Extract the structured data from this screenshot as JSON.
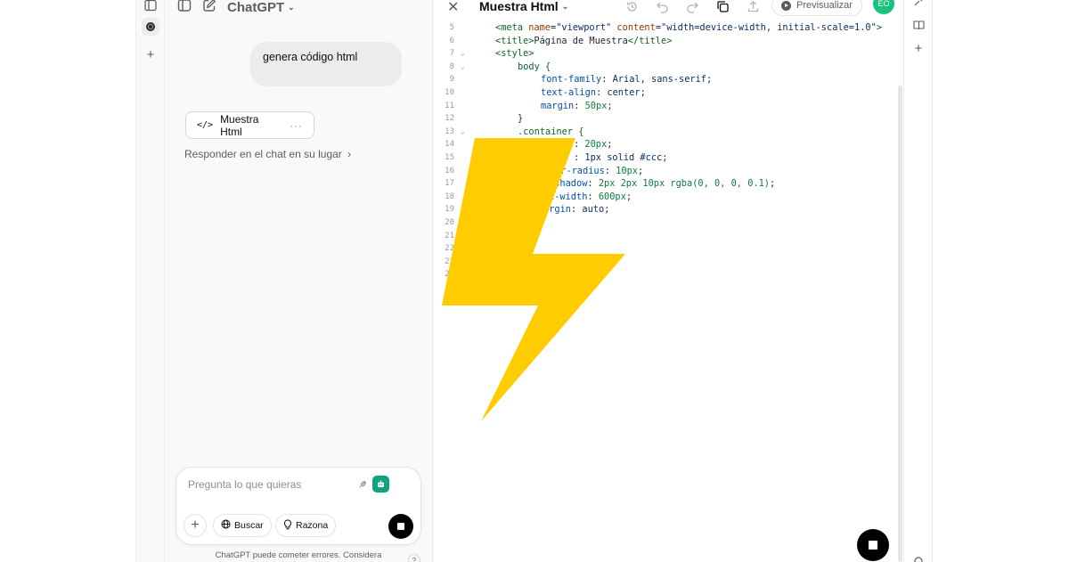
{
  "chat": {
    "title": "ChatGPT",
    "user_message": "genera código html",
    "canvas_chip_label": "Muestra Html",
    "canvas_chip_more": "···",
    "respond_link": "Responder en el chat en su lugar",
    "composer": {
      "placeholder": "Pregunta lo que quieras",
      "search_label": "Buscar",
      "reason_label": "Razona"
    },
    "disclaimer": "ChatGPT puede cometer errores. Considera",
    "help": "?"
  },
  "canvas": {
    "title": "Muestra Html",
    "preview_label": "Previsualizar",
    "avatar_initials": "EO",
    "code_lines": [
      {
        "n": "5",
        "fold": false
      },
      {
        "n": "6",
        "fold": false
      },
      {
        "n": "7",
        "fold": true
      },
      {
        "n": "8",
        "fold": true
      },
      {
        "n": "9",
        "fold": false
      },
      {
        "n": "10",
        "fold": false
      },
      {
        "n": "11",
        "fold": false
      },
      {
        "n": "12",
        "fold": false
      },
      {
        "n": "13",
        "fold": true
      },
      {
        "n": "14",
        "fold": false
      },
      {
        "n": "15",
        "fold": false
      },
      {
        "n": "16",
        "fold": false
      },
      {
        "n": "17",
        "fold": false
      },
      {
        "n": "18",
        "fold": false
      },
      {
        "n": "19",
        "fold": false
      },
      {
        "n": "20",
        "fold": false
      },
      {
        "n": "21",
        "fold": false
      },
      {
        "n": "22",
        "fold": false
      },
      {
        "n": "23",
        "fold": false
      },
      {
        "n": "24",
        "fold": false
      }
    ],
    "code_text": {
      "l5a": "<meta ",
      "l5b": "name",
      "l5c": "=",
      "l5d": "\"viewport\"",
      "l5e": " content",
      "l5f": "=",
      "l5g": "\"width=device-width, initial-scale=1.0\"",
      "l5h": ">",
      "l6a": "<title>",
      "l6b": "Página de Muestra",
      "l6c": "</title>",
      "l7": "<style>",
      "l8": "body {",
      "l9a": "font-family",
      "l9b": ": ",
      "l9c": "Arial, sans-serif",
      "l9d": ";",
      "l10a": "text-align",
      "l10b": ": ",
      "l10c": "center",
      "l10d": ";",
      "l11a": "margin",
      "l11b": ": ",
      "l11c": "50px",
      "l11d": ";",
      "l12": "}",
      "l13": ".container {",
      "l14a": ": ",
      "l14b": "20px",
      "l14c": ";",
      "l15a": ": ",
      "l15b": "1px solid #ccc",
      "l15c": ";",
      "l16a": "er-radius",
      "l16b": ": ",
      "l16c": "10px",
      "l16d": ";",
      "l17a": "-shadow",
      "l17b": ": ",
      "l17c": "2px 2px 10px rgba(0, 0, 0, 0.1)",
      "l17d": ";",
      "l18a": "x-width",
      "l18b": ": ",
      "l18c": "600px",
      "l18d": ";",
      "l19a": "argin",
      "l19b": ": ",
      "l19c": "auto",
      "l19d": ";",
      "l21": ">"
    }
  },
  "colors": {
    "bolt": "#ffcc00",
    "avatar": "#19c37d",
    "bot": "#10a37f"
  }
}
